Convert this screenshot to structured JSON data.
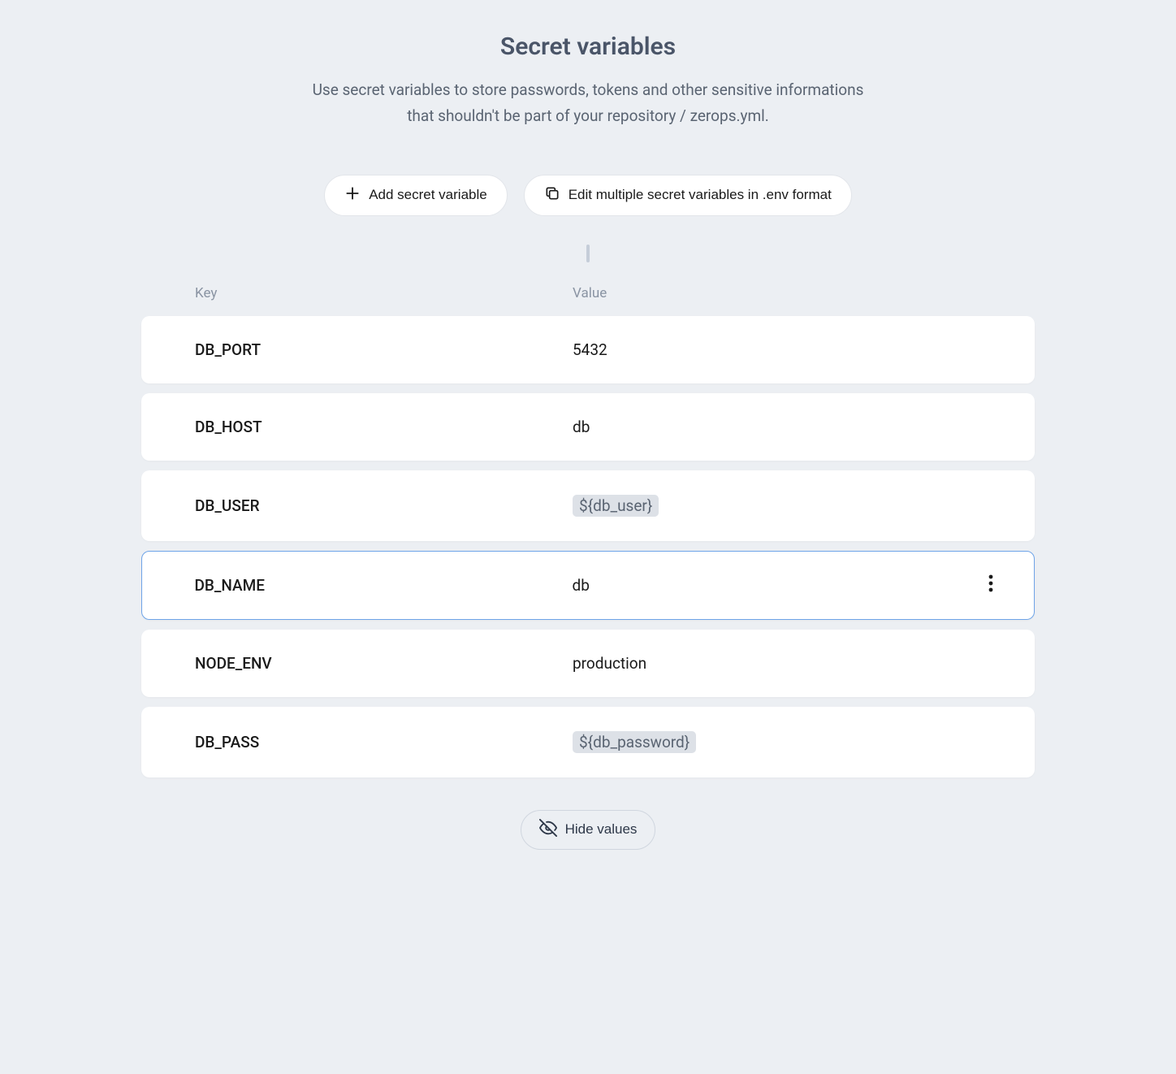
{
  "header": {
    "title": "Secret variables",
    "description": "Use secret variables to store passwords, tokens and other sensitive informations that shouldn't be part of your repository / zerops.yml."
  },
  "actions": {
    "add_label": "Add secret variable",
    "edit_label": "Edit multiple secret variables in .env format"
  },
  "table": {
    "columns": {
      "key": "Key",
      "value": "Value"
    },
    "rows": [
      {
        "key": "DB_PORT",
        "value": "5432",
        "chip": false,
        "active": false
      },
      {
        "key": "DB_HOST",
        "value": "db",
        "chip": false,
        "active": false
      },
      {
        "key": "DB_USER",
        "value": "${db_user}",
        "chip": true,
        "active": false
      },
      {
        "key": "DB_NAME",
        "value": "db",
        "chip": false,
        "active": true
      },
      {
        "key": "NODE_ENV",
        "value": "production",
        "chip": false,
        "active": false
      },
      {
        "key": "DB_PASS",
        "value": "${db_password}",
        "chip": true,
        "active": false
      }
    ]
  },
  "footer": {
    "hide_label": "Hide values"
  }
}
